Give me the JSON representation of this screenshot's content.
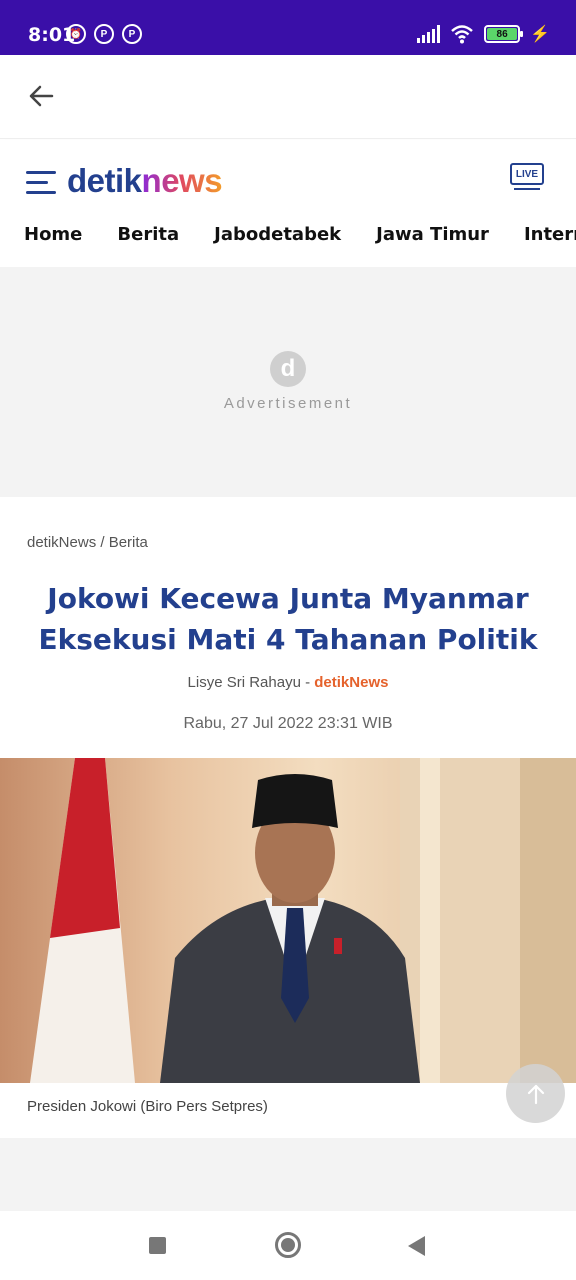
{
  "status_bar": {
    "time": "8:01",
    "battery": "86",
    "bg_color": "#3a0fa8"
  },
  "header": {
    "logo_part1": "detik",
    "logo_part2": "news",
    "live_label": "LIVE",
    "nav": [
      "Home",
      "Berita",
      "Jabodetabek",
      "Jawa Timur",
      "Internasi"
    ]
  },
  "ad": {
    "logo_letter": "d",
    "label": "Advertisement"
  },
  "article": {
    "breadcrumb": "detikNews / Berita",
    "title": "Jokowi Kecewa Junta Myanmar Eksekusi Mati 4 Tahanan Politik",
    "author": "Lisye Sri Rahayu",
    "separator": " - ",
    "source": "detikNews",
    "date": "Rabu, 27 Jul 2022 23:31 WIB",
    "caption": "Presiden Jokowi (Biro Pers Setpres)"
  },
  "colors": {
    "brand_blue": "#23408e",
    "source_orange": "#e5622c"
  }
}
